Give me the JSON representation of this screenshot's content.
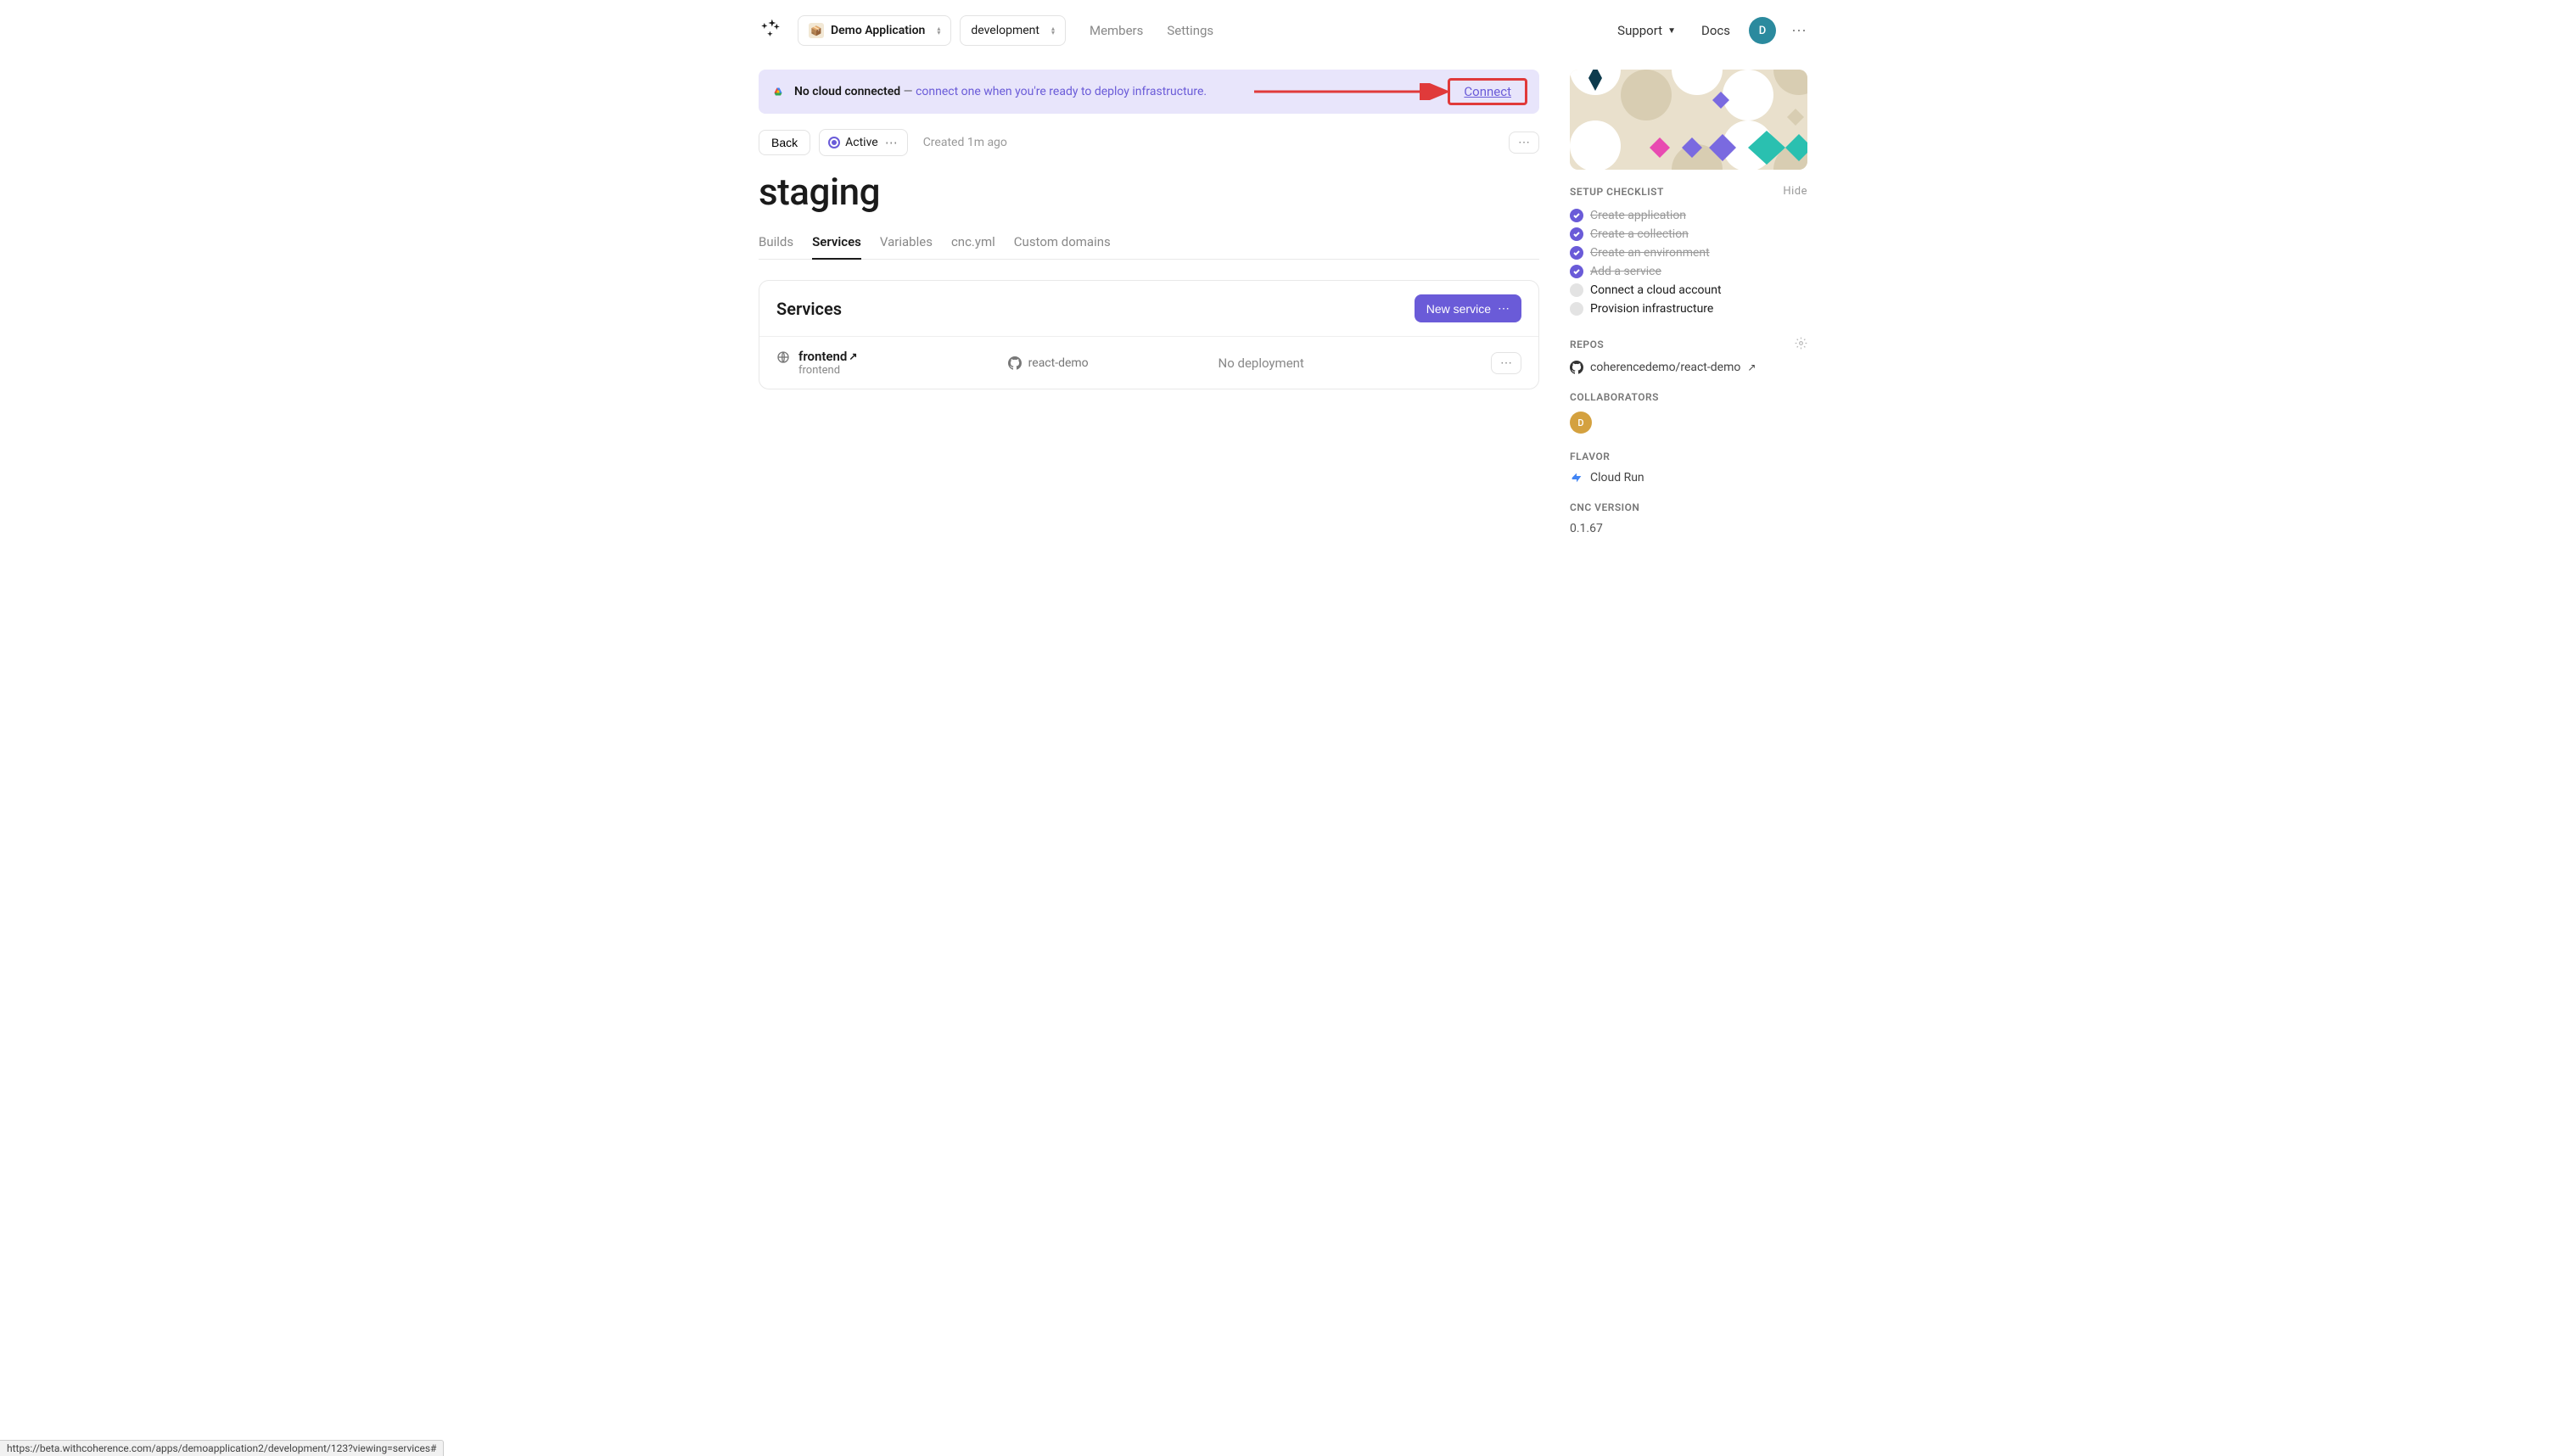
{
  "header": {
    "app_selector": "Demo Application",
    "env_selector": "development",
    "members": "Members",
    "settings": "Settings",
    "support": "Support",
    "docs": "Docs",
    "avatar_initial": "D"
  },
  "alert": {
    "bold": "No cloud connected",
    "dash": " — ",
    "sub": "connect one when you're ready to deploy infrastructure.",
    "connect": "Connect"
  },
  "rowbar": {
    "back": "Back",
    "status": "Active",
    "created": "Created 1m ago"
  },
  "title": "staging",
  "tabs": {
    "builds": "Builds",
    "services": "Services",
    "variables": "Variables",
    "cnc": "cnc.yml",
    "domains": "Custom domains"
  },
  "services": {
    "heading": "Services",
    "new_btn": "New service",
    "row": {
      "name": "frontend",
      "sub": "frontend",
      "repo": "react-demo",
      "deploy": "No deployment"
    }
  },
  "side": {
    "setup_title": "SETUP CHECKLIST",
    "hide": "Hide",
    "checklist": {
      "c1": "Create application",
      "c2": "Create a collection",
      "c3": "Create an environment",
      "c4": "Add a service",
      "c5": "Connect a cloud account",
      "c6": "Provision infrastructure"
    },
    "repos_title": "REPOS",
    "repo": "coherencedemo/react-demo",
    "collab_title": "COLLABORATORS",
    "collab_initial": "D",
    "flavor_title": "FLAVOR",
    "flavor": "Cloud Run",
    "ver_title": "CNC VERSION",
    "ver": "0.1.67"
  },
  "statusbar": "https://beta.withcoherence.com/apps/demoapplication2/development/123?viewing=services#"
}
